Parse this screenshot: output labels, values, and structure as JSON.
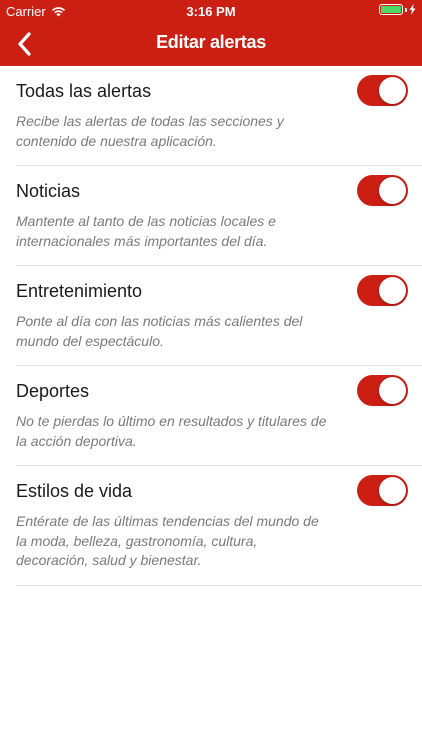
{
  "status_bar": {
    "carrier": "Carrier",
    "time": "3:16 PM",
    "battery_color": "#4cd964"
  },
  "navbar": {
    "title": "Editar alertas",
    "back_icon": "chevron-left-icon",
    "background": "#cc1f14"
  },
  "alerts": [
    {
      "title": "Todas las alertas",
      "description": "Recibe las alertas de todas las secciones y contenido de nuestra aplicación.",
      "enabled": true
    },
    {
      "title": "Noticias",
      "description": "Mantente al tanto de las noticias locales e internacionales más importantes del día.",
      "enabled": true
    },
    {
      "title": "Entretenimiento",
      "description": "Ponte al día con las noticias más calientes del mundo del espectáculo.",
      "enabled": true
    },
    {
      "title": "Deportes",
      "description": "No te pierdas lo último en resultados y titulares de la acción deportiva.",
      "enabled": true
    },
    {
      "title": "Estilos de vida",
      "description": "Entérate de las últimas tendencias del mundo de la moda, belleza, gastronomía, cultura, decoración, salud y bienestar.",
      "enabled": true
    }
  ]
}
